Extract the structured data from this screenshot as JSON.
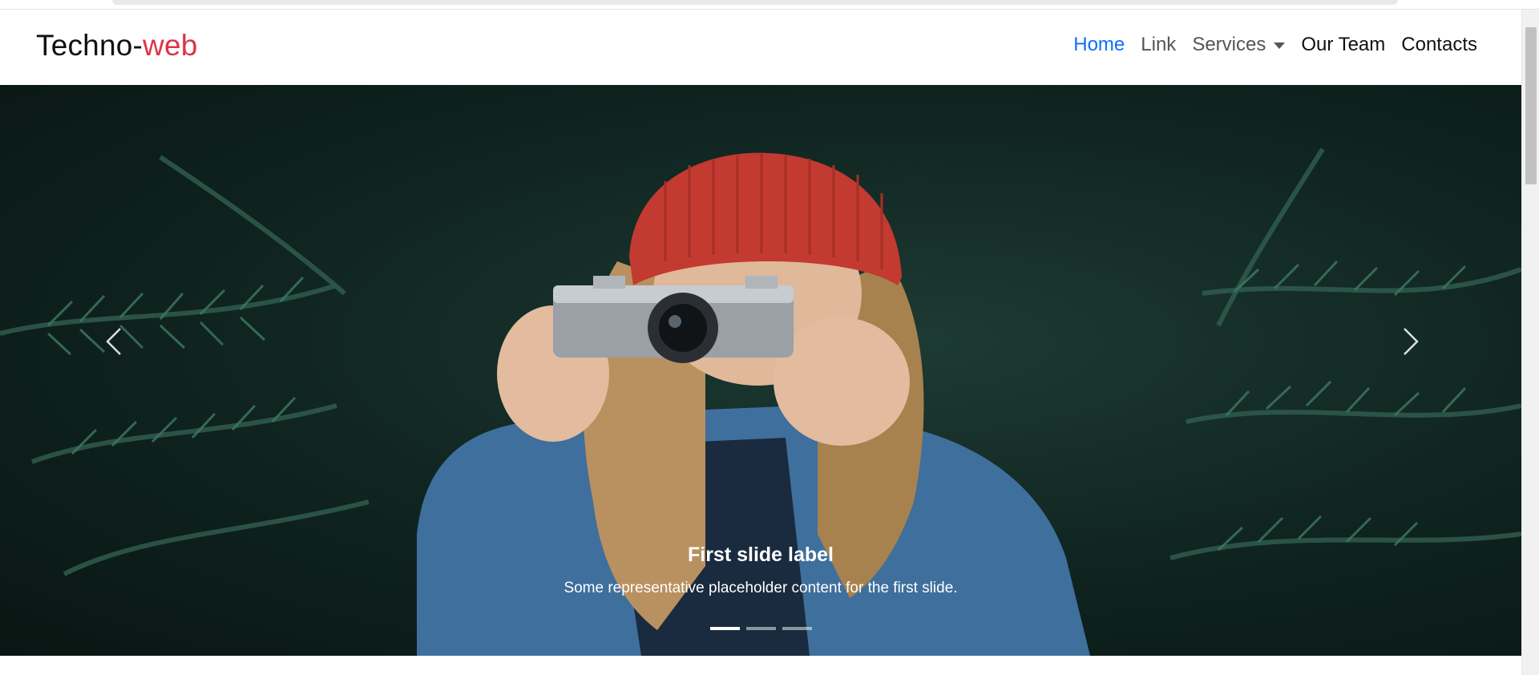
{
  "brand": {
    "prefix": "Techno-",
    "accent": "web",
    "accent_color": "#dc3545"
  },
  "nav": {
    "home": "Home",
    "link": "Link",
    "services": "Services",
    "our_team": "Our Team",
    "contacts": "Contacts",
    "active_color": "#0d6efd"
  },
  "carousel": {
    "caption_title": "First slide label",
    "caption_text": "Some representative placeholder content for the first slide.",
    "slide_count": 3,
    "active_slide": 1,
    "prev_icon": "chevron-left-icon",
    "next_icon": "chevron-right-icon"
  }
}
